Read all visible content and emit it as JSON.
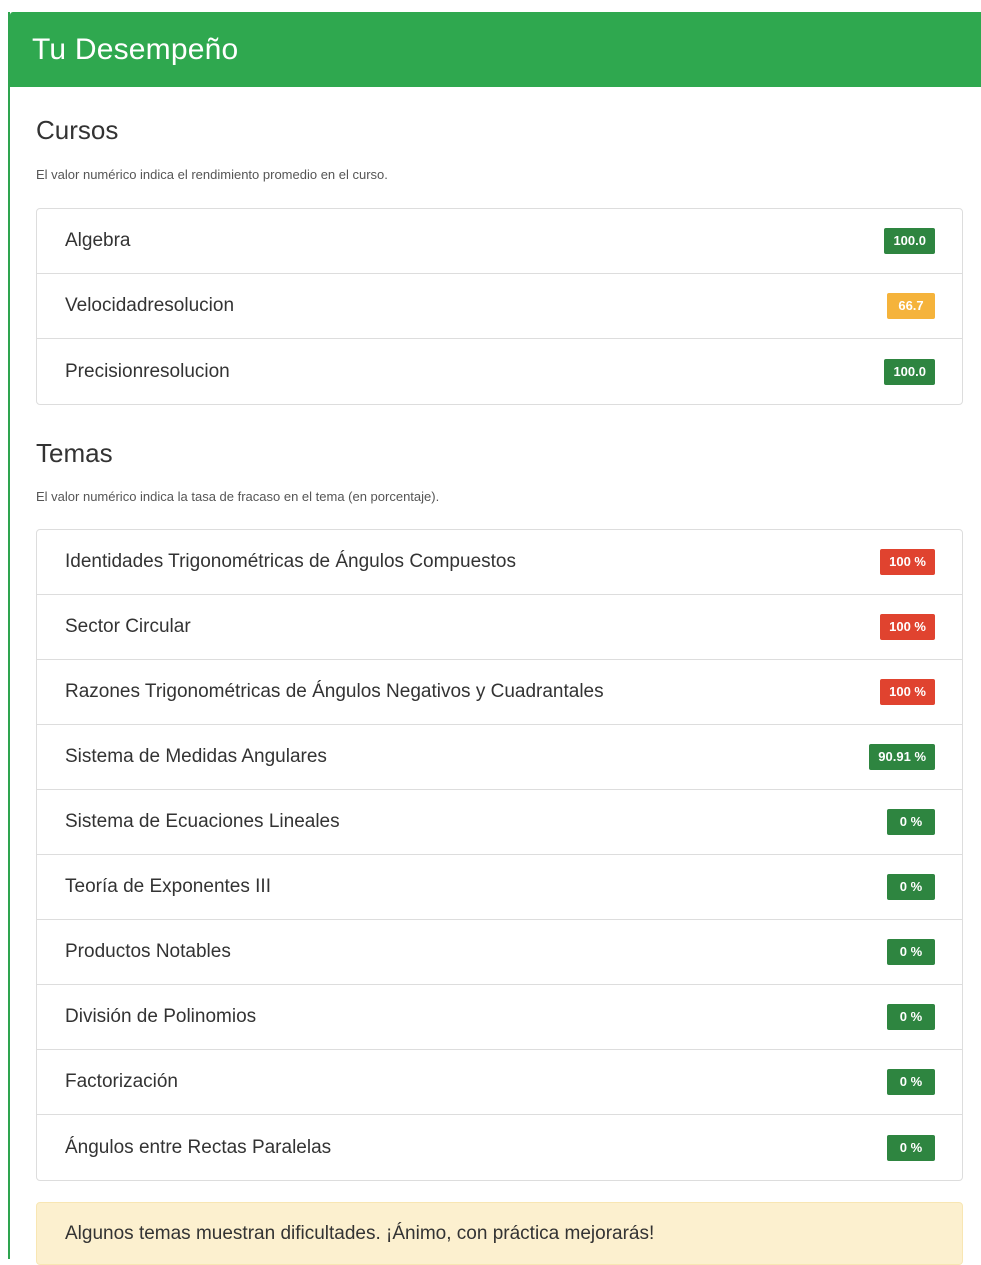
{
  "header": {
    "title": "Tu Desempeño"
  },
  "colors": {
    "green": "#2e8540",
    "orange": "#f5b33b",
    "red": "#e0432f",
    "header_green": "#2fa84f"
  },
  "cursos": {
    "title": "Cursos",
    "subtitle": "El valor numérico indica el rendimiento promedio en el curso.",
    "items": [
      {
        "label": "Algebra",
        "value": "100.0",
        "status": "green"
      },
      {
        "label": "Velocidadresolucion",
        "value": "66.7",
        "status": "orange"
      },
      {
        "label": "Precisionresolucion",
        "value": "100.0",
        "status": "green"
      }
    ]
  },
  "temas": {
    "title": "Temas",
    "subtitle": "El valor numérico indica la tasa de fracaso en el tema (en porcentaje).",
    "items": [
      {
        "label": "Identidades Trigonométricas de Ángulos Compuestos",
        "value": "100 %",
        "status": "red"
      },
      {
        "label": "Sector Circular",
        "value": "100 %",
        "status": "red"
      },
      {
        "label": "Razones Trigonométricas de Ángulos Negativos y Cuadrantales",
        "value": "100 %",
        "status": "red"
      },
      {
        "label": "Sistema de Medidas Angulares",
        "value": "90.91 %",
        "status": "green"
      },
      {
        "label": "Sistema de Ecuaciones Lineales",
        "value": "0 %",
        "status": "green"
      },
      {
        "label": "Teoría de Exponentes III",
        "value": "0 %",
        "status": "green"
      },
      {
        "label": "Productos Notables",
        "value": "0 %",
        "status": "green"
      },
      {
        "label": "División de Polinomios",
        "value": "0 %",
        "status": "green"
      },
      {
        "label": "Factorización",
        "value": "0 %",
        "status": "green"
      },
      {
        "label": "Ángulos entre Rectas Paralelas",
        "value": "0 %",
        "status": "green"
      }
    ]
  },
  "alert": {
    "text": "Algunos temas muestran dificultades. ¡Ánimo, con práctica mejorarás!"
  }
}
